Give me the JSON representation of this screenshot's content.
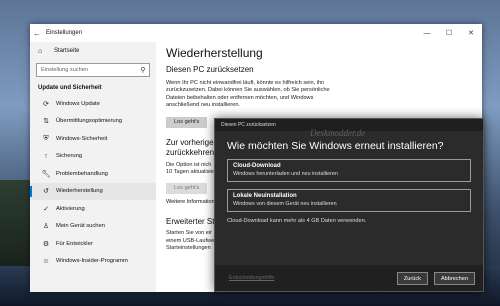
{
  "window": {
    "title": "Einstellungen",
    "min": "—",
    "max": "☐",
    "close": "✕"
  },
  "sidebar": {
    "home": "Startseite",
    "search_placeholder": "Einstellung suchen",
    "section": "Update und Sicherheit",
    "items": [
      {
        "label": "Windows Update",
        "icon": "sync-icon"
      },
      {
        "label": "Übermittlungsoptimierung",
        "icon": "delivery-icon"
      },
      {
        "label": "Windows-Sicherheit",
        "icon": "shield-icon"
      },
      {
        "label": "Sicherung",
        "icon": "backup-icon"
      },
      {
        "label": "Problembehandlung",
        "icon": "wrench-icon"
      },
      {
        "label": "Wiederherstellung",
        "icon": "recovery-icon",
        "active": true
      },
      {
        "label": "Aktivierung",
        "icon": "check-circle-icon"
      },
      {
        "label": "Mein Gerät suchen",
        "icon": "person-icon"
      },
      {
        "label": "Für Entwickler",
        "icon": "developer-icon"
      },
      {
        "label": "Windows-Insider-Programm",
        "icon": "insider-icon"
      }
    ]
  },
  "content": {
    "title": "Wiederherstellung",
    "reset_heading": "Diesen PC zurücksetzen",
    "reset_text_1": "Wenn Ihr PC nicht einwandfrei läuft, könnte es hilfreich sein, ihn",
    "reset_text_2": "zurückzusetzen. Dabei können Sie auswählen, ob Sie persönliche",
    "reset_text_3": "Dateien beibehalten oder entfernen möchten, und Windows",
    "reset_text_4": "anschließend neu installieren.",
    "reset_button": "Los geht's",
    "prev_heading_1": "Zur vorherige",
    "prev_heading_2": "zurückkehren",
    "prev_text_1": "Die Option ist nich",
    "prev_text_2": "10 Tagen aktualisiert",
    "prev_button": "Los geht's",
    "more_info": "Weitere Information",
    "adv_heading": "Erweiterter Sta",
    "adv_text_1": "Starten Sie von eir",
    "adv_text_2": "einem USB-Laufwerk",
    "adv_text_3": "Starteinstellungen"
  },
  "dialog": {
    "titlebar": "Diesen PC zurücksetzen",
    "heading": "Wie möchten Sie Windows erneut installieren?",
    "options": [
      {
        "title": "Cloud-Download",
        "desc": "Windows herunterladen und neu installieren"
      },
      {
        "title": "Lokale Neuinstallation",
        "desc": "Windows von diesem Gerät neu installieren"
      }
    ],
    "note": "Cloud-Download kann mehr als 4 GB Daten verwenden.",
    "help_link": "Entscheidungshilfe",
    "back_button": "Zurück",
    "cancel_button": "Abbrechen"
  },
  "watermark": "Deskmodder.de"
}
